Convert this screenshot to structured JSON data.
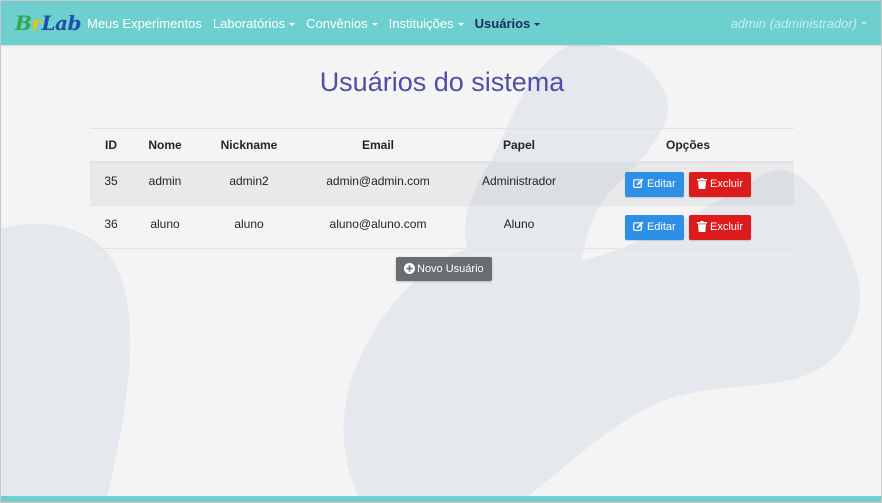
{
  "navbar": {
    "brand_parts": [
      "B",
      "r",
      "Lab"
    ],
    "items": [
      {
        "label": "Meus Experimentos",
        "dropdown": false,
        "active": false
      },
      {
        "label": "Laboratórios",
        "dropdown": true,
        "active": false
      },
      {
        "label": "Convênios",
        "dropdown": true,
        "active": false
      },
      {
        "label": "Instituições",
        "dropdown": true,
        "active": false
      },
      {
        "label": "Usuários",
        "dropdown": true,
        "active": true
      }
    ],
    "user_label": "admin (administrador)",
    "colors": {
      "background": "#6ecfcf",
      "active_text": "#1e2a5a"
    }
  },
  "main": {
    "title": "Usuários do sistema",
    "table": {
      "headers": {
        "id": "ID",
        "nome": "Nome",
        "nickname": "Nickname",
        "email": "Email",
        "papel": "Papel",
        "opcoes": "Opções"
      },
      "rows": [
        {
          "id": "35",
          "nome": "admin",
          "nickname": "admin2",
          "email": "admin@admin.com",
          "papel": "Administrador"
        },
        {
          "id": "36",
          "nome": "aluno",
          "nickname": "aluno",
          "email": "aluno@aluno.com",
          "papel": "Aluno"
        }
      ],
      "actions": {
        "edit_label": "Editar",
        "delete_label": "Excluir"
      }
    },
    "new_user_label": "Novo Usuário"
  },
  "colors": {
    "title": "#4e4fa9",
    "edit_button": "#2e8fe6",
    "delete_button": "#dc1c1c",
    "new_button": "#6a6d70"
  },
  "icons": {
    "edit": "edit-icon",
    "delete": "trash-icon",
    "new": "plus-circle-icon"
  }
}
